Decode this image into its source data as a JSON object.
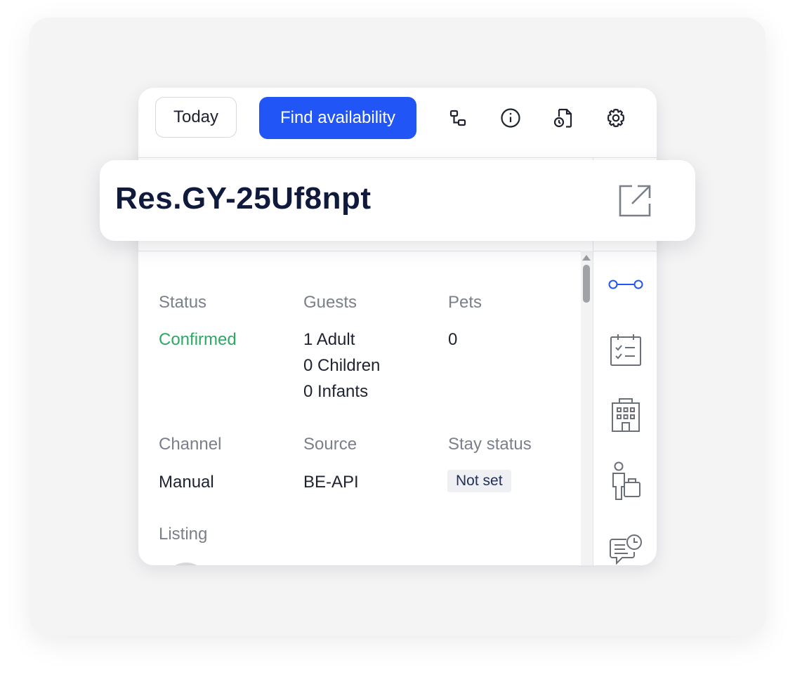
{
  "toolbar": {
    "today_label": "Today",
    "find_availability_label": "Find availability",
    "icons": [
      "hierarchy-icon",
      "info-icon",
      "document-sync-icon",
      "gear-icon"
    ]
  },
  "reservation": {
    "id": "Res.GY-25Uf8npt",
    "open_icon": "external-link-icon"
  },
  "details": {
    "status_label": "Status",
    "status_value": "Confirmed",
    "guests_label": "Guests",
    "guests_values": [
      "1 Adult",
      "0 Children",
      "0 Infants"
    ],
    "pets_label": "Pets",
    "pets_value": "0",
    "channel_label": "Channel",
    "channel_value": "Manual",
    "source_label": "Source",
    "source_value": "BE-API",
    "stay_status_label": "Stay status",
    "stay_status_value": "Not set",
    "listing_label": "Listing"
  },
  "side_rail": {
    "icons": [
      "timeline-icon",
      "task-calendar-icon",
      "building-icon",
      "guest-luggage-icon",
      "message-clock-icon"
    ]
  },
  "colors": {
    "primary": "#2255f5",
    "confirmed": "#2ea864",
    "label": "#7a7f8a",
    "text": "#1f2230",
    "title": "#101a3c",
    "rail_active": "#2255f5",
    "rail_icon": "#6b6f78"
  }
}
